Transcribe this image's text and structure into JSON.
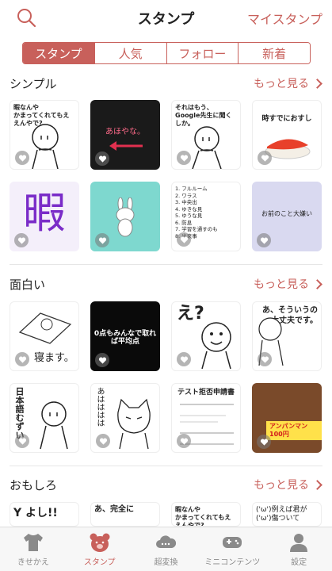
{
  "header": {
    "title": "スタンプ",
    "my_stamp": "マイスタンプ"
  },
  "segments": [
    {
      "label": "スタンプ",
      "active": true
    },
    {
      "label": "人気",
      "active": false
    },
    {
      "label": "フォロー",
      "active": false
    },
    {
      "label": "新着",
      "active": false
    }
  ],
  "sections": [
    {
      "title": "シンプル",
      "more": "もっと見る",
      "tiles": [
        {
          "caption": "暇なんや\nかまってくれてもええんやで?"
        },
        {
          "caption": "あほやな。"
        },
        {
          "caption": "それはもう、\nGoogle先生に聞くしか。"
        },
        {
          "caption": "時すでにおすし"
        },
        {
          "caption": "暇"
        },
        {
          "caption": ""
        },
        {
          "caption": "1. フルルーム\n2. ワラス\n3. 中央出\n4. ゆきな見\n5. ゆうな見\n6. 防息\n7. 学習を通すのも\n8. 出来事"
        },
        {
          "caption": "お前のこと大嫌い"
        }
      ]
    },
    {
      "title": "面白い",
      "more": "もっと見る",
      "tiles": [
        {
          "caption": "寝ます。"
        },
        {
          "caption": "0点もみんなで取れば平均点"
        },
        {
          "caption": "え?"
        },
        {
          "caption": "あ、そういうの\n大丈夫です。"
        },
        {
          "caption": "日本語むずい"
        },
        {
          "caption": "あはははは"
        },
        {
          "caption": "テスト拒否申請書"
        },
        {
          "caption": "アンパンマン 100円"
        }
      ]
    },
    {
      "title": "おもしろ",
      "more": "もっと見る",
      "tiles": [
        {
          "caption": "Y よし!!"
        },
        {
          "caption": "あ、完全に"
        },
        {
          "caption": "暇なんや\nかまってくれてもええんやで?"
        },
        {
          "caption": "('ω')例えば君が\n('ω')傷ついて"
        }
      ]
    }
  ],
  "tabbar": [
    {
      "label": "きせかえ",
      "icon": "shirt-icon",
      "active": false
    },
    {
      "label": "スタンプ",
      "icon": "bear-icon",
      "active": true
    },
    {
      "label": "超変換",
      "icon": "cloud-icon",
      "active": false
    },
    {
      "label": "ミニコンテンツ",
      "icon": "gamepad-icon",
      "active": false
    },
    {
      "label": "設定",
      "icon": "person-icon",
      "active": false
    }
  ],
  "colors": {
    "accent": "#c8605b",
    "dark_tile": "#1a1a1a",
    "mint_tile": "#7ed8cf",
    "lavender_tile": "#d9d9f0"
  }
}
